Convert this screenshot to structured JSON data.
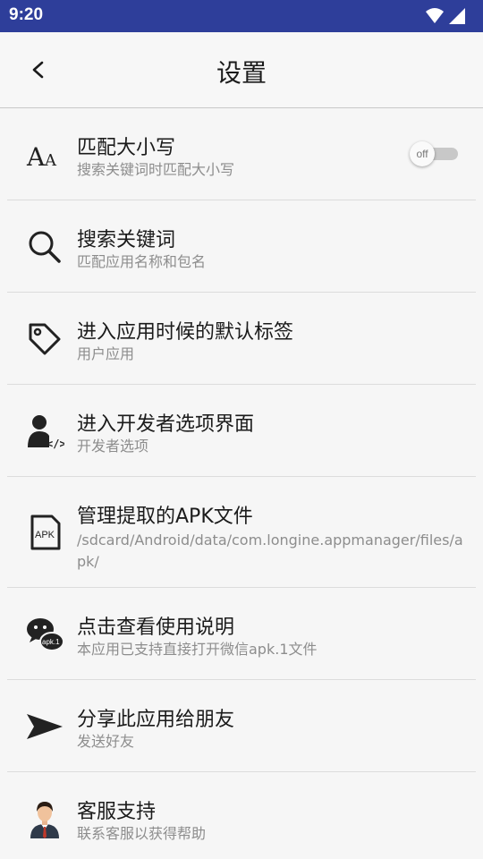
{
  "status_bar": {
    "time": "9:20",
    "icons": [
      "wifi-icon",
      "signal-icon"
    ],
    "background": "#2e3e9a"
  },
  "header": {
    "title": "设置",
    "back_icon": "back-arrow-icon"
  },
  "settings": [
    {
      "icon": "font-case-icon",
      "title": "匹配大小写",
      "subtitle": "搜索关键词时匹配大小写",
      "toggle": {
        "state": "off",
        "label": "off"
      }
    },
    {
      "icon": "search-icon",
      "title": "搜索关键词",
      "subtitle": "匹配应用名称和包名"
    },
    {
      "icon": "tag-icon",
      "title": "进入应用时候的默认标签",
      "subtitle": "用户应用"
    },
    {
      "icon": "developer-icon",
      "title": "进入开发者选项界面",
      "subtitle": "开发者选项"
    },
    {
      "icon": "apk-file-icon",
      "icon_text": "APK",
      "title": "管理提取的APK文件",
      "subtitle": "/sdcard/Android/data/com.longine.appmanager/files/apk/"
    },
    {
      "icon": "wechat-apk-icon",
      "icon_text": "apk.1",
      "title": "点击查看使用说明",
      "subtitle": "本应用已支持直接打开微信apk.1文件"
    },
    {
      "icon": "send-icon",
      "title": "分享此应用给朋友",
      "subtitle": "发送好友"
    },
    {
      "icon": "support-agent-icon",
      "title": "客服支持",
      "subtitle": "联系客服以获得帮助"
    }
  ]
}
